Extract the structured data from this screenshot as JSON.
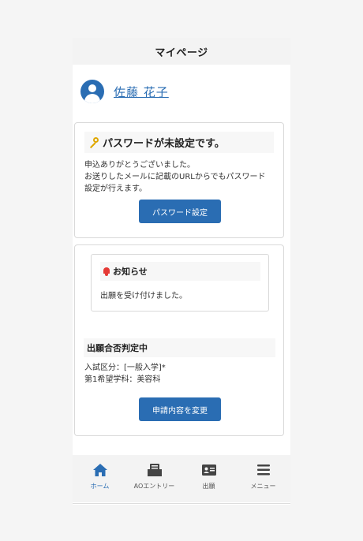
{
  "header": {
    "title": "マイページ"
  },
  "user": {
    "name": "佐藤 花子"
  },
  "password_card": {
    "title": "パスワードが未設定です。",
    "line1": "申込ありがとうございました。",
    "line2": "お送りしたメールに記載のURLからでもパスワード",
    "line3": "設定が行えます。",
    "button": "パスワード設定"
  },
  "notice": {
    "title": "お知らせ",
    "text": "出願を受け付けました。"
  },
  "status": {
    "title": "出願合否判定中",
    "line1": "入試区分：[一般入学]*",
    "line2": "第1希望学科：美容科",
    "button": "申請内容を変更"
  },
  "tabs": [
    {
      "label": "ホーム",
      "icon": "home-icon",
      "active": true
    },
    {
      "label": "AOエントリー",
      "icon": "inbox-icon",
      "active": false
    },
    {
      "label": "出願",
      "icon": "id-card-icon",
      "active": false
    },
    {
      "label": "メニュー",
      "icon": "menu-icon",
      "active": false
    }
  ],
  "colors": {
    "accent": "#2a6db3",
    "key": "#e0a800",
    "bell": "#e53935"
  }
}
